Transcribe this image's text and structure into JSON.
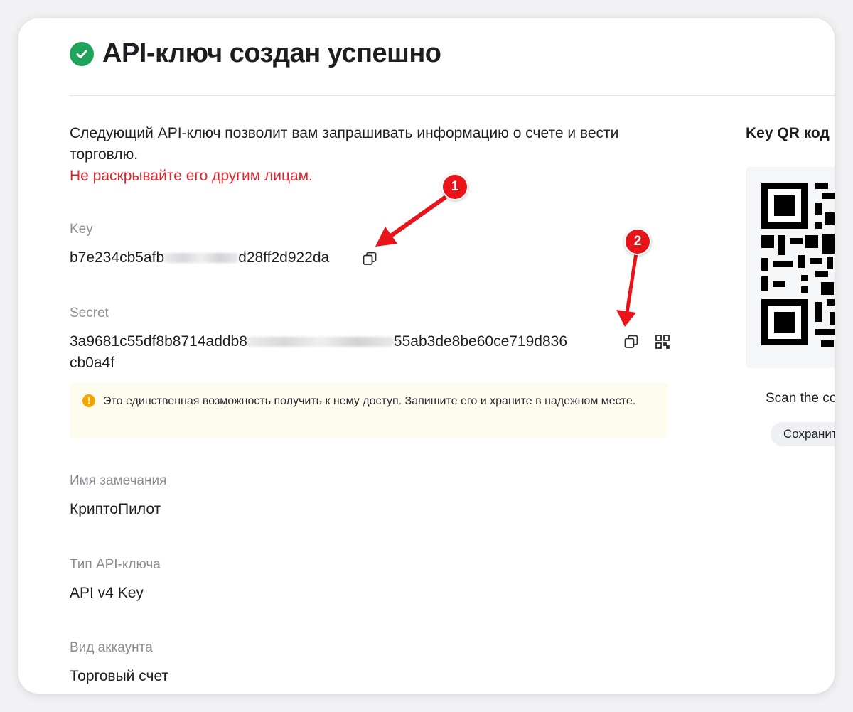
{
  "header": {
    "title": "API-ключ создан успешно",
    "status_icon": "check-circle-icon",
    "status_color": "#1fa35a"
  },
  "intro": {
    "text": "Следующий API-ключ позволит вам запрашивать информацию о счете и вести торговлю.",
    "warning": "Не раскрывайте его другим лицам.",
    "warning_color": "#e0262b"
  },
  "key": {
    "label": "Key",
    "value_start": "b7e234cb5afb",
    "value_end": "d28ff2d922da",
    "copy_icon": "copy-icon"
  },
  "secret": {
    "label": "Secret",
    "value_start": "3a9681c55df8b8714addb8",
    "value_end": "55ab3de8be60ce719d836",
    "value_line2": "cb0a4f",
    "copy_icon": "copy-icon",
    "qr_icon": "qr-code-icon"
  },
  "notice": {
    "text": "Это единственная возможность получить к нему доступ. Запишите его и храните в надежном месте.",
    "icon": "exclamation-icon",
    "color": "#f4a400"
  },
  "fields": [
    {
      "label": "Имя замечания",
      "value": "КриптоПилот"
    },
    {
      "label": "Тип API-ключа",
      "value": "API v4 Key"
    },
    {
      "label": "Вид аккаунта",
      "value": "Торговый счет"
    }
  ],
  "qr": {
    "title": "Key QR код",
    "scan_text": "Scan the co",
    "save_label": "Сохранит"
  },
  "annotations": [
    {
      "number": "1"
    },
    {
      "number": "2"
    }
  ],
  "annotation_color": "#e8141a"
}
